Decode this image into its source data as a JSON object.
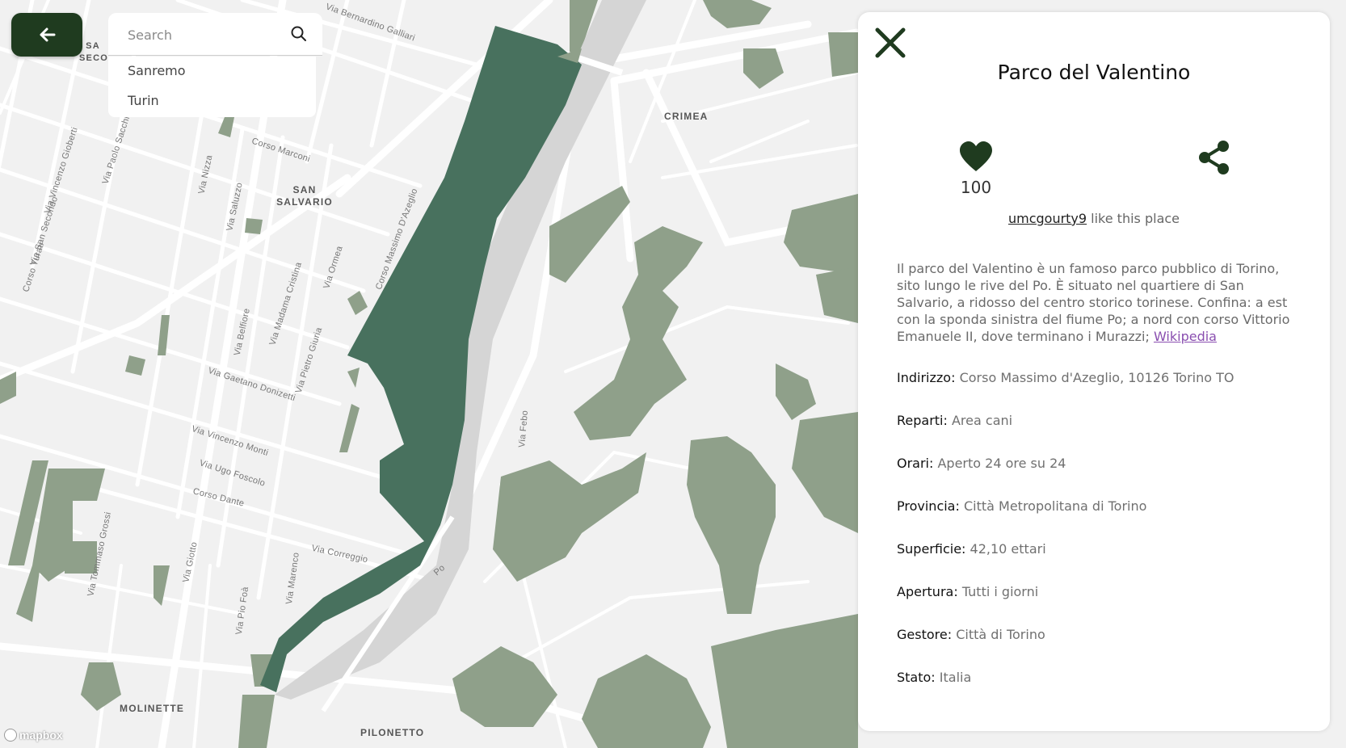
{
  "map": {
    "colors": {
      "background": "#f1f1f1",
      "streets": "#ffffff",
      "greenery": "#8fa08a",
      "highlighted_park": "#48715e",
      "river": "#d5d5d5"
    },
    "labels": [
      "Via Bernardino Galliari",
      "Corso Marconi",
      "Via Nizza",
      "Via Saluzzo",
      "Via Paolo Sacchi",
      "Via Vincenzo Gioberti",
      "Via San Secondo",
      "Corso Turati",
      "Via Madama Cristina",
      "Via Belfiore",
      "Via Ormea",
      "Corso Massimo D'Azeglio",
      "Via Pietro Giuria",
      "Via Gaetano Donizetti",
      "Via Vincenzo Monti",
      "Via Ugo Foscolo",
      "Corso Dante",
      "Via Correggio",
      "Via Febo",
      "Po",
      "Via Giotto",
      "Via Pio Foà",
      "Via Tommaso Grossi",
      "Via Marenco"
    ],
    "districts": [
      "SAN SALVARIO",
      "CRIMEA",
      "MOLINETTE",
      "PILONETTO",
      "SA SECO"
    ],
    "attribution": "mapbox"
  },
  "toolbar": {
    "back_icon": "arrow-left-icon"
  },
  "search": {
    "placeholder": "Search",
    "icon": "search-icon",
    "results": [
      "Sanremo",
      "Turin"
    ]
  },
  "place": {
    "close_icon": "close-icon",
    "title": "Parco del Valentino",
    "likes": {
      "icon": "heart-icon",
      "count": "100",
      "user": "umcgourty9",
      "suffix": " like this place"
    },
    "share_icon": "share-icon",
    "accent_color": "#1f3b1f",
    "description": {
      "text": "Il parco del Valentino è un famoso parco pubblico di Torino, sito lungo le rive del Po. È situato nel quartiere di San Salvario, a ridosso del centro storico torinese. Confina: a est con la sponda sinistra del fiume Po; a nord con corso Vittorio Emanuele II, dove terminano i Murazzi; ",
      "link": "Wikipedia"
    },
    "fields": [
      {
        "label": "Indirizzo:",
        "value": "Corso Massimo d'Azeglio, 10126 Torino TO"
      },
      {
        "label": "Reparti:",
        "value": "Area cani"
      },
      {
        "label": "Orari:",
        "value": "Aperto 24 ore su 24"
      },
      {
        "label": "Provincia:",
        "value": "Città Metropolitana di Torino"
      },
      {
        "label": "Superficie:",
        "value": "42,10 ettari"
      },
      {
        "label": "Apertura:",
        "value": "Tutti i giorni"
      },
      {
        "label": "Gestore:",
        "value": "Città di Torino"
      },
      {
        "label": "Stato:",
        "value": "Italia"
      }
    ]
  }
}
